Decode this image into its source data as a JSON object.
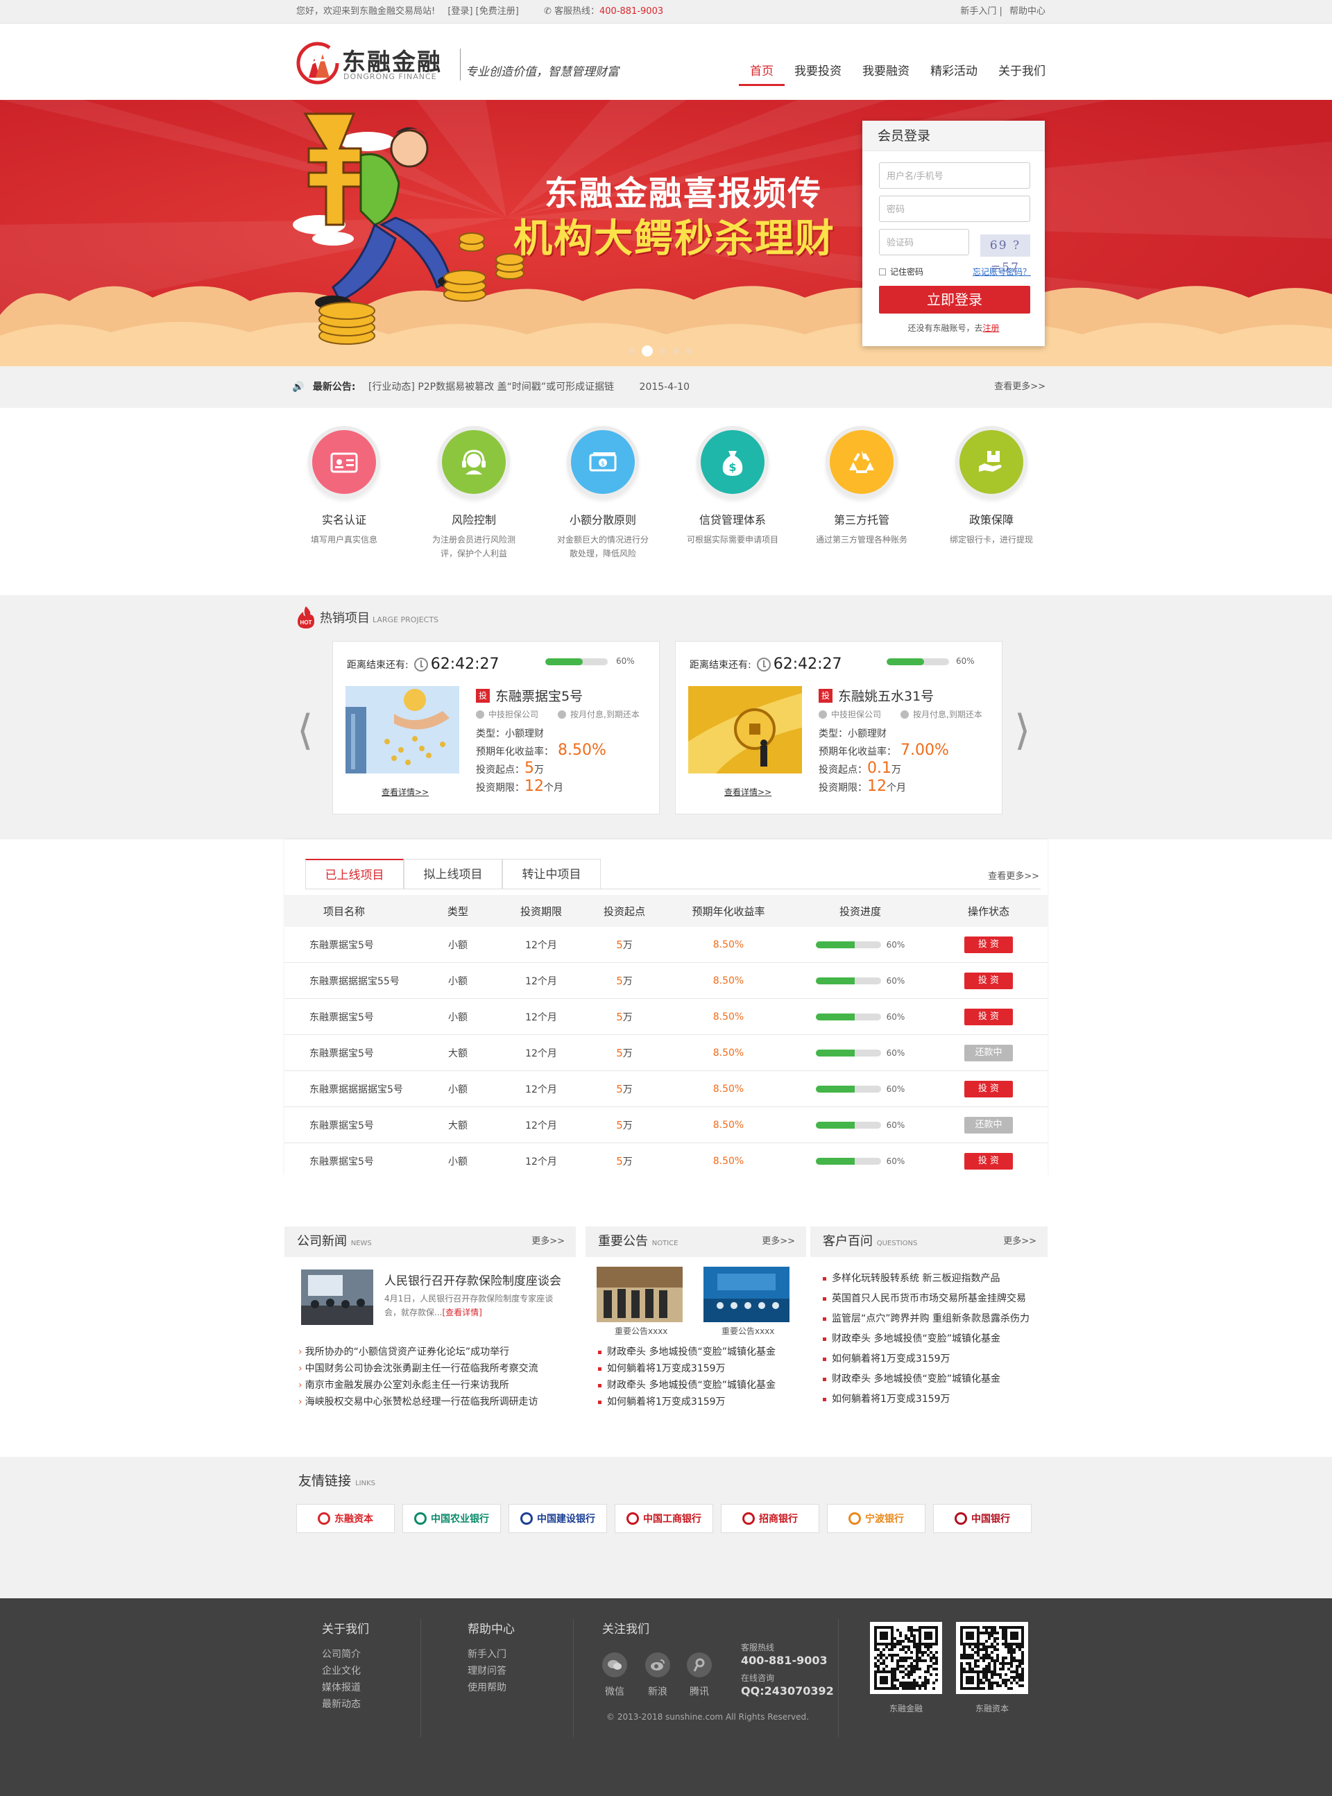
{
  "topbar": {
    "welcome": "您好，欢迎来到东融金融交易局站!",
    "login": "[登录]",
    "register": "[免费注册]",
    "hotline_label": "客服热线：",
    "hotline": "400-881-9003",
    "newbie": "新手入门",
    "help": "帮助中心"
  },
  "header": {
    "logo_cn": "东融金融",
    "logo_en": "DONGRONG FINANCE",
    "slogan": "专业创造价值，智慧管理财富",
    "nav": [
      "首页",
      "我要投资",
      "我要融资",
      "精彩活动",
      "关于我们"
    ]
  },
  "banner": {
    "line1": "东融金融喜报频传",
    "line2": "机构大鳄秒杀理财",
    "slide_count": 5,
    "active_slide": 2
  },
  "login": {
    "title": "会员登录",
    "user_placeholder": "用户名/手机号",
    "pwd_placeholder": "密码",
    "code_placeholder": "验证码",
    "captcha": "69 ? =57",
    "remember": "记住密码",
    "forgot": "忘记账号密码？",
    "submit": "立即登录",
    "no_account": "还没有东融账号，去",
    "register_link": "注册"
  },
  "notice": {
    "label": "最新公告:",
    "text": "[行业动态] P2P数据易被篡改 盖“时间戳”或可形成证据链",
    "date": "2015-4-10",
    "more": "查看更多>>"
  },
  "features": [
    {
      "title": "实名认证",
      "desc": "填写用户真实信息",
      "color": "#f3677d"
    },
    {
      "title": "风险控制",
      "desc": "为注册会员进行风险测评，保护个人利益",
      "color": "#8cc63f"
    },
    {
      "title": "小额分散原则",
      "desc": "对金额巨大的情况进行分散处理，降低风险",
      "color": "#4cb8ee"
    },
    {
      "title": "信贷管理体系",
      "desc": "可根据实际需要申请项目",
      "color": "#1fb7aa"
    },
    {
      "title": "第三方托管",
      "desc": "通过第三方管理各种账务",
      "color": "#fdb927"
    },
    {
      "title": "政策保障",
      "desc": "绑定银行卡，进行提现",
      "color": "#a8c52a"
    }
  ],
  "hot": {
    "title": "热销项目",
    "subtitle": "LARGE PROJECTS",
    "countdown_label": "距离结束还有:",
    "cards": [
      {
        "time": "62:42:27",
        "progress": 60,
        "progress_label": "60%",
        "name": "东融票据宝5号",
        "guarantor": "中技担保公司",
        "repay": "按月付息,到期还本",
        "type": "类型：小额理财",
        "rate_label": "预期年化收益率：",
        "rate": "8.50%",
        "min_label": "投资起点：",
        "min": "5",
        "min_unit": "万",
        "term_label": "投资期限：",
        "term": "12",
        "term_unit": "个月",
        "detail": "查看详情>>"
      },
      {
        "time": "62:42:27",
        "progress": 60,
        "progress_label": "60%",
        "name": "东融姚五水31号",
        "guarantor": "中技担保公司",
        "repay": "按月付息,到期还本",
        "type": "类型：小额理财",
        "rate_label": "预期年化收益率：",
        "rate": "7.00%",
        "min_label": "投资起点：",
        "min": "0.1",
        "min_unit": "万",
        "term_label": "投资期限：",
        "term": "12",
        "term_unit": "个月",
        "detail": "查看详情>>"
      }
    ]
  },
  "projects": {
    "tabs": [
      "已上线项目",
      "拟上线项目",
      "转让中项目"
    ],
    "more": "查看更多>>",
    "headers": [
      "项目名称",
      "类型",
      "投资期限",
      "投资起点",
      "预期年化收益率",
      "投资进度",
      "操作状态"
    ],
    "rows": [
      {
        "name": "东融票据宝5号",
        "type": "小额",
        "term": "12个月",
        "min": "5",
        "unit": "万",
        "rate": "8.50%",
        "progress": 60,
        "plabel": "60%",
        "action": "投 资",
        "state": "invest"
      },
      {
        "name": "东融票据据据宝55号",
        "type": "小额",
        "term": "12个月",
        "min": "5",
        "unit": "万",
        "rate": "8.50%",
        "progress": 60,
        "plabel": "60%",
        "action": "投 资",
        "state": "invest"
      },
      {
        "name": "东融票据宝5号",
        "type": "小额",
        "term": "12个月",
        "min": "5",
        "unit": "万",
        "rate": "8.50%",
        "progress": 60,
        "plabel": "60%",
        "action": "投 资",
        "state": "invest"
      },
      {
        "name": "东融票据宝5号",
        "type": "大额",
        "term": "12个月",
        "min": "5",
        "unit": "万",
        "rate": "8.50%",
        "progress": 60,
        "plabel": "60%",
        "action": "还款中",
        "state": "repay"
      },
      {
        "name": "东融票据据据据宝5号",
        "type": "小额",
        "term": "12个月",
        "min": "5",
        "unit": "万",
        "rate": "8.50%",
        "progress": 60,
        "plabel": "60%",
        "action": "投 资",
        "state": "invest"
      },
      {
        "name": "东融票据宝5号",
        "type": "大额",
        "term": "12个月",
        "min": "5",
        "unit": "万",
        "rate": "8.50%",
        "progress": 60,
        "plabel": "60%",
        "action": "还款中",
        "state": "repay"
      },
      {
        "name": "东融票据宝5号",
        "type": "小额",
        "term": "12个月",
        "min": "5",
        "unit": "万",
        "rate": "8.50%",
        "progress": 60,
        "plabel": "60%",
        "action": "投 资",
        "state": "invest"
      }
    ]
  },
  "company_news": {
    "title": "公司新闻",
    "subtitle": "NEWS",
    "more": "更多>>",
    "headline": "人民银行召开存款保险制度座谈会",
    "summary": "4月1日，人民银行召开存款保险制度专家座谈会，就存款保...",
    "detail": "[查看详情]",
    "items": [
      "我所协办的“小额信贷资产证券化论坛”成功举行",
      "中国财务公司协会沈张勇副主任一行莅临我所考察交流",
      "南京市金融发展办公室刘永彪主任一行来访我所",
      "海峡股权交易中心张赞松总经理一行莅临我所调研走访"
    ]
  },
  "important": {
    "title": "重要公告",
    "subtitle": "NOTICE",
    "more": "更多>>",
    "captions": [
      "重要公告xxxx",
      "重要公告xxxx"
    ],
    "items": [
      "财政牵头 多地城投债“变脸”城镇化基金",
      "如何躺着将1万变成3159万",
      "财政牵头 多地城投债“变脸”城镇化基金",
      "如何躺着将1万变成3159万"
    ]
  },
  "qa": {
    "title": "客户百问",
    "subtitle": "QUESTIONS",
    "more": "更多>>",
    "items": [
      "多样化玩转股转系统 新三板迎指数产品",
      "英国首只人民币货币市场交易所基金挂牌交易",
      "监管层“点穴”跨界并购 重组新条款恳露杀伤力",
      "财政牵头 多地城投债“变脸”城镇化基金",
      "如何躺着将1万变成3159万",
      "财政牵头 多地城投债“变脸”城镇化基金",
      "如何躺着将1万变成3159万"
    ]
  },
  "links": {
    "title": "友情链接",
    "subtitle": "LINKS",
    "items": [
      {
        "name": "东融资本",
        "color": "#d9262c"
      },
      {
        "name": "中国农业银行",
        "color": "#0a8a6a"
      },
      {
        "name": "中国建设银行",
        "color": "#1b3f94"
      },
      {
        "name": "中国工商银行",
        "color": "#c8161e"
      },
      {
        "name": "招商银行",
        "color": "#c8161e"
      },
      {
        "name": "宁波银行",
        "color": "#e8891b"
      },
      {
        "name": "中国银行",
        "color": "#b1101e"
      }
    ]
  },
  "footer": {
    "about": "关于我们",
    "about_items": [
      "公司简介",
      "企业文化",
      "媒体报道",
      "最新动态"
    ],
    "help": "帮助中心",
    "help_items": [
      "新手入门",
      "理财问答",
      "使用帮助"
    ],
    "follow": "关注我们",
    "social": [
      "微信",
      "新浪",
      "腾讯"
    ],
    "hotline_label": "客服热线",
    "hotline": "400-881-9003",
    "online_label": "在线咨询",
    "qq": "QQ:243070392",
    "copyright": "© 2013-2018 sunshine.com   All Rights Reserved.",
    "qr1": "东融金融",
    "qr2": "东融资本"
  }
}
